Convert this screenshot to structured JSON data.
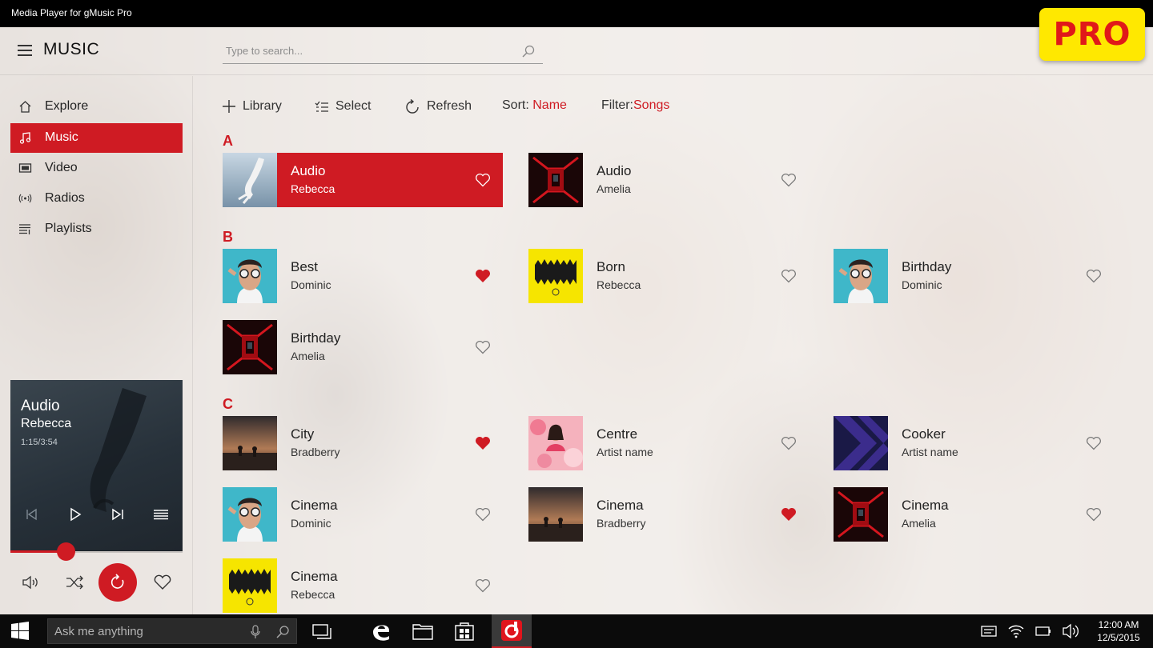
{
  "window": {
    "title": "Media Player for gMusic Pro",
    "badge": "PRO"
  },
  "header": {
    "title": "MUSIC",
    "search_placeholder": "Type to search..."
  },
  "sidebar": {
    "items": [
      {
        "label": "Explore",
        "icon": "home-icon"
      },
      {
        "label": "Music",
        "icon": "music-note-icon",
        "active": true
      },
      {
        "label": "Video",
        "icon": "video-icon"
      },
      {
        "label": "Radios",
        "icon": "radio-icon"
      },
      {
        "label": "Playlists",
        "icon": "playlist-icon"
      }
    ]
  },
  "now_playing": {
    "title": "Audio",
    "artist": "Rebecca",
    "time": "1:15/3:54",
    "progress": 0.32
  },
  "toolbar": {
    "library_label": "Library",
    "select_label": "Select",
    "refresh_label": "Refresh",
    "sort_prefix": "Sort:",
    "sort_value": "Name",
    "filter_prefix": "Filter:",
    "filter_value": "Songs"
  },
  "sections": [
    {
      "letter": "A",
      "songs": [
        {
          "title": "Audio",
          "artist": "Rebecca",
          "favorite": false,
          "selected": true,
          "art": "hand-art"
        },
        {
          "title": "Audio",
          "artist": "Amelia",
          "favorite": false,
          "art": "hallway-art"
        }
      ]
    },
    {
      "letter": "B",
      "songs": [
        {
          "title": "Best",
          "artist": "Dominic",
          "favorite": true,
          "art": "man-glasses-art"
        },
        {
          "title": "Born",
          "artist": "Rebecca",
          "favorite": false,
          "art": "yellow-art"
        },
        {
          "title": "Birthday",
          "artist": "Dominic",
          "favorite": false,
          "art": "man-glasses-art"
        },
        {
          "title": "Birthday",
          "artist": "Amelia",
          "favorite": false,
          "art": "hallway-art"
        }
      ]
    },
    {
      "letter": "C",
      "songs": [
        {
          "title": "City",
          "artist": "Bradberry",
          "favorite": true,
          "art": "sunset-art"
        },
        {
          "title": "Centre",
          "artist": "Artist name",
          "favorite": false,
          "art": "pink-art"
        },
        {
          "title": "Cooker",
          "artist": "Artist name",
          "favorite": false,
          "art": "stripes-art"
        },
        {
          "title": "Cinema",
          "artist": "Dominic",
          "favorite": false,
          "art": "man-glasses-art"
        },
        {
          "title": "Cinema",
          "artist": "Bradberry",
          "favorite": true,
          "art": "sunset-art"
        },
        {
          "title": "Cinema",
          "artist": "Amelia",
          "favorite": false,
          "art": "hallway-art"
        },
        {
          "title": "Cinema",
          "artist": "Rebecca",
          "favorite": false,
          "art": "yellow-art"
        }
      ]
    }
  ],
  "taskbar": {
    "search_placeholder": "Ask me anything",
    "time": "12:00 AM",
    "date": "12/5/2015"
  },
  "colors": {
    "accent": "#cf1b23",
    "badge_bg": "#ffe800"
  }
}
